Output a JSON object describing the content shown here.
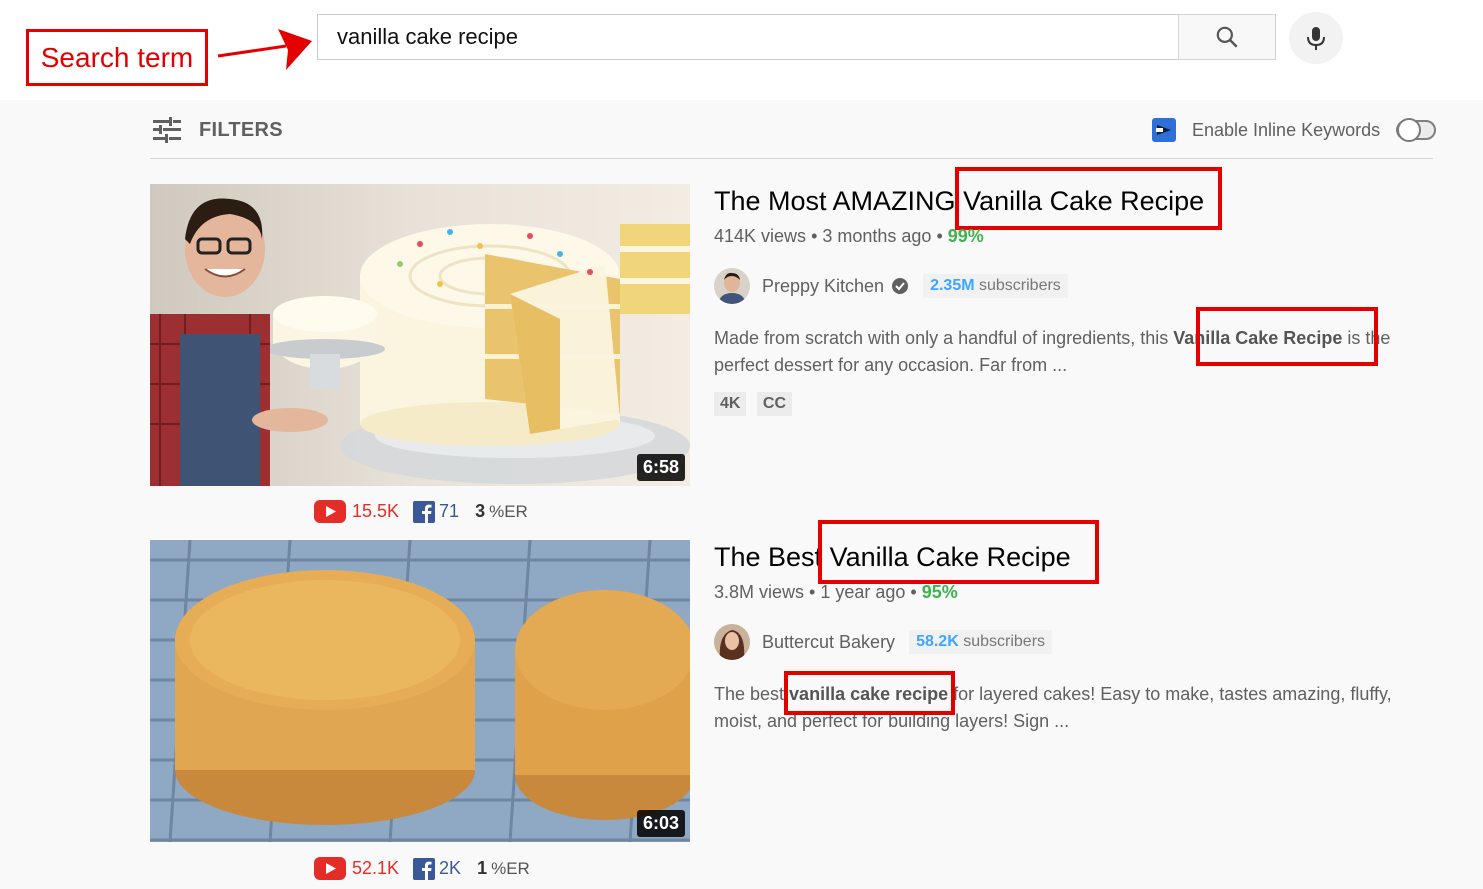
{
  "annotation": {
    "search_term_label": "Search term"
  },
  "search": {
    "query": "vanilla cake recipe"
  },
  "filters": {
    "label": "FILTERS"
  },
  "inline_keywords": {
    "label": "Enable Inline Keywords",
    "enabled": false
  },
  "results": [
    {
      "title_prefix": "The Most AMAZING ",
      "title_keyword": "Vanilla Cake Recipe",
      "views": "414K views",
      "age": "3 months ago",
      "score": "99%",
      "channel": "Preppy Kitchen",
      "verified": true,
      "subscribers_count": "2.35M",
      "subscribers_label": "subscribers",
      "desc_before": "Made from scratch with only a handful of ingredients, this ",
      "desc_keyword": "Vanilla Cake Recipe",
      "desc_after": " is the perfect dessert for any occasion. Far from ...",
      "tags": [
        "4K",
        "CC"
      ],
      "duration": "6:58",
      "yt_count": "15.5K",
      "fb_count": "71",
      "er_value": "3",
      "er_unit": "%ER"
    },
    {
      "title_prefix": "The Best ",
      "title_keyword": "Vanilla Cake Recipe",
      "views": "3.8M views",
      "age": "1 year ago",
      "score": "95%",
      "channel": "Buttercut Bakery",
      "verified": false,
      "subscribers_count": "58.2K",
      "subscribers_label": "subscribers",
      "desc_before": "The best ",
      "desc_keyword": "vanilla cake recipe",
      "desc_after": " for layered cakes! Easy to make, tastes amazing, fluffy, moist, and perfect for building layers! Sign ...",
      "tags": [],
      "duration": "6:03",
      "yt_count": "52.1K",
      "fb_count": "2K",
      "er_value": "1",
      "er_unit": "%ER"
    }
  ],
  "colors": {
    "annotation_red": "#e50000",
    "youtube_red": "#e52d27",
    "facebook_blue": "#3b5998",
    "score_green": "#3eb34f",
    "subscriber_blue": "#3ea6ff"
  }
}
